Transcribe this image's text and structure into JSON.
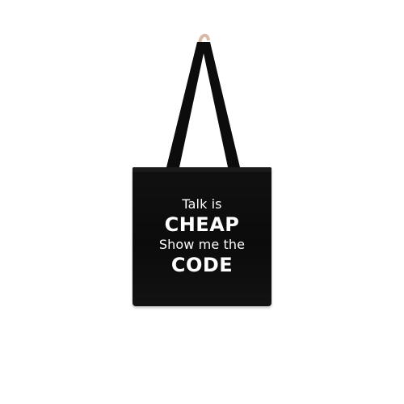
{
  "product": {
    "type": "tote-bag",
    "bag_color": "#0b0b0b",
    "text_color": "#ffffff",
    "print_lines": [
      "Talk is",
      "CHEAP",
      "Show me the",
      "CODE"
    ]
  }
}
